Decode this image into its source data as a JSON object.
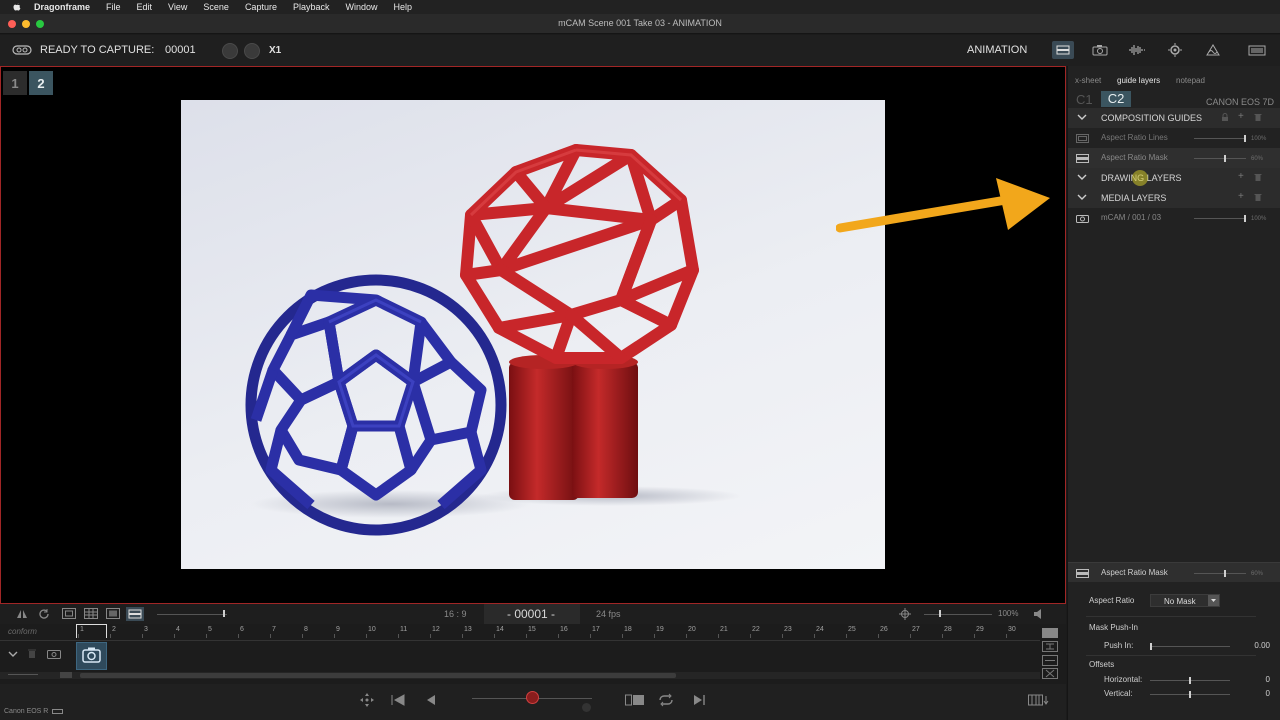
{
  "menubar": {
    "app": "Dragonframe",
    "items": [
      "File",
      "Edit",
      "View",
      "Scene",
      "Capture",
      "Playback",
      "Window",
      "Help"
    ]
  },
  "window": {
    "title": "mCAM  Scene 001  Take 03 - ANIMATION"
  },
  "status": {
    "ready_label": "READY TO CAPTURE:",
    "frame": "00001",
    "exposure": "X1",
    "mode": "ANIMATION"
  },
  "viewer": {
    "cameras": [
      "1",
      "2"
    ]
  },
  "panel": {
    "tabs": [
      "x-sheet",
      "guide layers",
      "notepad"
    ],
    "cam_tabs": [
      "C1",
      "C2"
    ],
    "camera_name": "CANON EOS 7D",
    "composition_guides": "COMPOSITION GUIDES",
    "aspect_lines": {
      "label": "Aspect Ratio Lines",
      "pct": "100%",
      "value": 1.0
    },
    "aspect_mask": {
      "label": "Aspect Ratio Mask",
      "pct": "60%",
      "value": 0.6
    },
    "drawing_layers": "DRAWING LAYERS",
    "media_layers": "MEDIA LAYERS",
    "media_item": {
      "label": "mCAM / 001 / 03",
      "pct": "100%",
      "value": 1.0
    }
  },
  "inspector": {
    "header": {
      "label": "Aspect Ratio Mask",
      "pct": "60%",
      "value": 0.6
    },
    "aspect_ratio_label": "Aspect Ratio",
    "aspect_ratio_value": "No Mask",
    "mask_push_in": "Mask Push-In",
    "push_in_label": "Push In:",
    "push_in_value": "0.00",
    "offsets": "Offsets",
    "horizontal_label": "Horizontal:",
    "horizontal_value": "0",
    "vertical_label": "Vertical:",
    "vertical_value": "0"
  },
  "viewbar": {
    "aspect": "16 : 9",
    "frame_display": "- 00001 -",
    "fps": "24 fps",
    "zoom": "100%"
  },
  "timeline": {
    "track_label": "conform",
    "frames": [
      "1",
      "2",
      "3",
      "4",
      "5",
      "6",
      "7",
      "8",
      "9",
      "10",
      "11",
      "12",
      "13",
      "14",
      "15",
      "16",
      "17",
      "18",
      "19",
      "20",
      "21",
      "22",
      "23",
      "24",
      "25",
      "26",
      "27",
      "28",
      "29",
      "30"
    ]
  },
  "footer": {
    "camera_label": "Canon EOS R"
  },
  "colors": {
    "accent_red": "#a12626",
    "arrow_orange": "#f2a71b",
    "active_cam": "#3b5560"
  }
}
